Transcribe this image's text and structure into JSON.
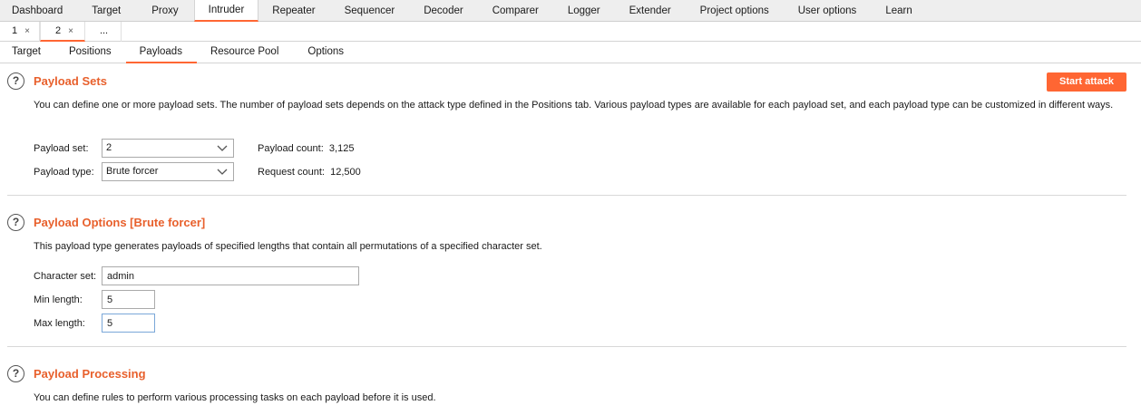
{
  "main_tabs": [
    "Dashboard",
    "Target",
    "Proxy",
    "Intruder",
    "Repeater",
    "Sequencer",
    "Decoder",
    "Comparer",
    "Logger",
    "Extender",
    "Project options",
    "User options",
    "Learn"
  ],
  "main_tab_active": "Intruder",
  "instance_tabs": [
    {
      "label": "1",
      "close": "×"
    },
    {
      "label": "2",
      "close": "×"
    },
    {
      "label": "...",
      "close": ""
    }
  ],
  "intruder_tabs": [
    "Target",
    "Positions",
    "Payloads",
    "Resource Pool",
    "Options"
  ],
  "intruder_tab_active": "Payloads",
  "colors": {
    "accent": "#ff6633",
    "heading": "#e8602c"
  },
  "payload_sets": {
    "help": "?",
    "title": "Payload Sets",
    "description": "You can define one or more payload sets. The number of payload sets depends on the attack type defined in the Positions tab. Various payload types are available for each payload set, and each payload type can be customized in different ways.",
    "start_attack": "Start attack",
    "set_label": "Payload set:",
    "set_value": "2",
    "type_label": "Payload type:",
    "type_value": "Brute forcer",
    "count_label": "Payload count:",
    "count_value": "3,125",
    "request_label": "Request count:",
    "request_value": "12,500"
  },
  "payload_options": {
    "help": "?",
    "title": "Payload Options [Brute forcer]",
    "description": "This payload type generates payloads of specified lengths that contain all permutations of a specified character set.",
    "charset_label": "Character set:",
    "charset_value": "admin",
    "min_label": "Min length:",
    "min_value": "5",
    "max_label": "Max length:",
    "max_value": "5"
  },
  "payload_processing": {
    "help": "?",
    "title": "Payload Processing",
    "description": "You can define rules to perform various processing tasks on each payload before it is used."
  }
}
